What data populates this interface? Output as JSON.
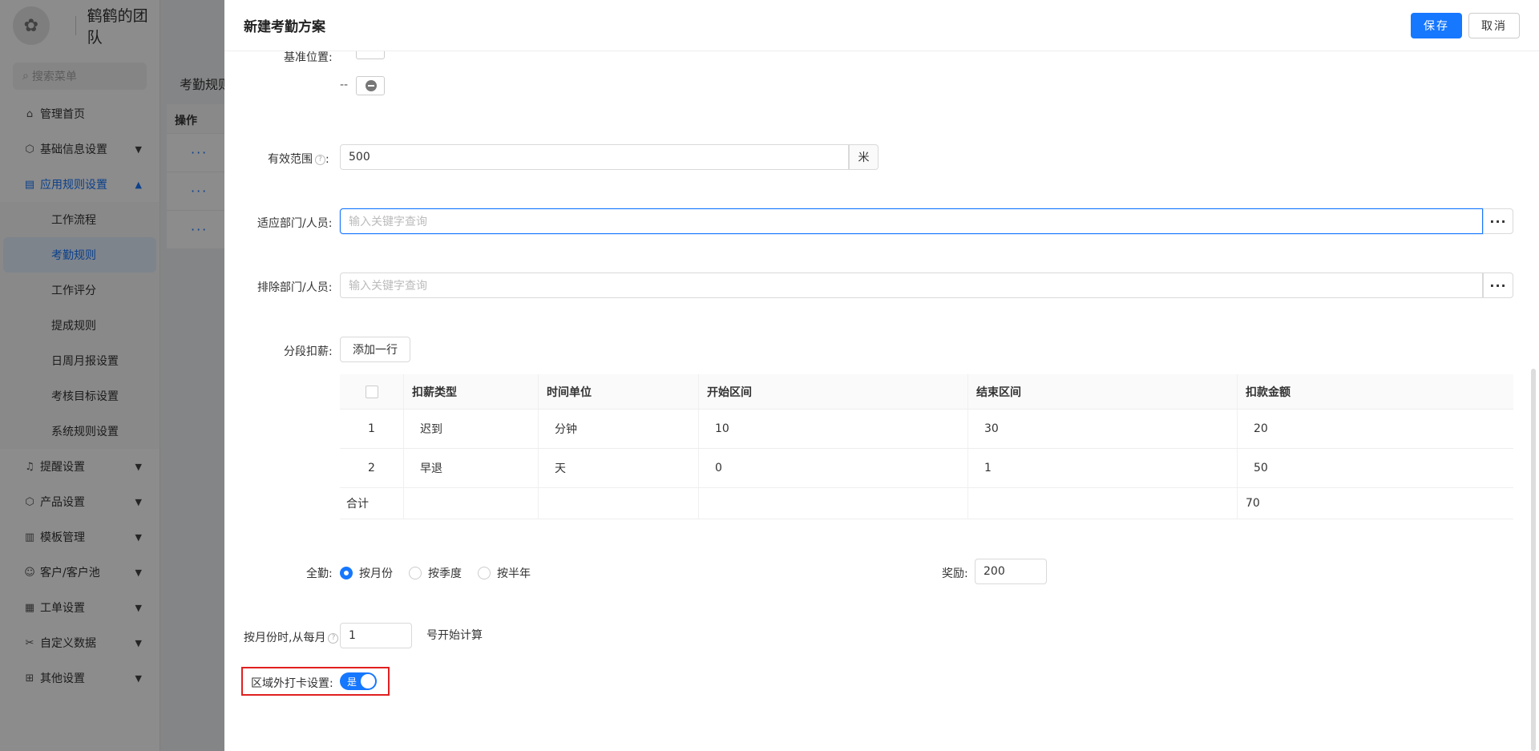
{
  "sidebar": {
    "brand_name": "鹤鹤的团队",
    "search_placeholder": "搜索菜单",
    "items": [
      {
        "label": "管理首页"
      },
      {
        "label": "基础信息设置"
      },
      {
        "label": "应用规则设置"
      },
      {
        "label": "提醒设置"
      },
      {
        "label": "产品设置"
      },
      {
        "label": "模板管理"
      },
      {
        "label": "客户/客户池"
      },
      {
        "label": "工单设置"
      },
      {
        "label": "自定义数据"
      },
      {
        "label": "其他设置"
      }
    ],
    "subitems": [
      {
        "label": "工作流程"
      },
      {
        "label": "考勤规则"
      },
      {
        "label": "工作评分"
      },
      {
        "label": "提成规则"
      },
      {
        "label": "日周月报设置"
      },
      {
        "label": "考核目标设置"
      },
      {
        "label": "系统规则设置"
      }
    ]
  },
  "main": {
    "title": "考勤规则",
    "table_header": "操作",
    "row_action": "···"
  },
  "drawer": {
    "title": "新建考勤方案",
    "save_label": "保存",
    "cancel_label": "取消",
    "base_position_label": "基准位置:",
    "dash_text": "--",
    "range_label": "有效范围",
    "range_value": "500",
    "range_unit": "米",
    "dept_label": "适应部门/人员:",
    "dept_placeholder": "输入关键字查询",
    "exclude_label": "排除部门/人员:",
    "exclude_placeholder": "输入关键字查询",
    "more_dots": "···",
    "deduct_label": "分段扣薪:",
    "add_row_label": "添加一行",
    "table": {
      "headers": [
        "扣薪类型",
        "时间单位",
        "开始区间",
        "结束区间",
        "扣款金额"
      ],
      "rows": [
        {
          "idx": "1",
          "type": "迟到",
          "unit": "分钟",
          "start": "10",
          "end": "30",
          "amount": "20"
        },
        {
          "idx": "2",
          "type": "早退",
          "unit": "天",
          "start": "0",
          "end": "1",
          "amount": "50"
        }
      ],
      "total_label": "合计",
      "total_amount": "70"
    },
    "attendance_label": "全勤:",
    "attendance_options": [
      "按月份",
      "按季度",
      "按半年"
    ],
    "attendance_selected": "按月份",
    "reward_label": "奖励:",
    "reward_value": "200",
    "month_start_label": "按月份时,从每月",
    "month_start_value": "1",
    "month_start_suffix": "号开始计算",
    "outside_label": "区域外打卡设置:",
    "outside_switch_text": "是",
    "outside_switch_on": true
  },
  "colors": {
    "primary": "#1677ff",
    "highlight": "#e02020",
    "overlay": "rgba(0,0,0,0.45)"
  }
}
